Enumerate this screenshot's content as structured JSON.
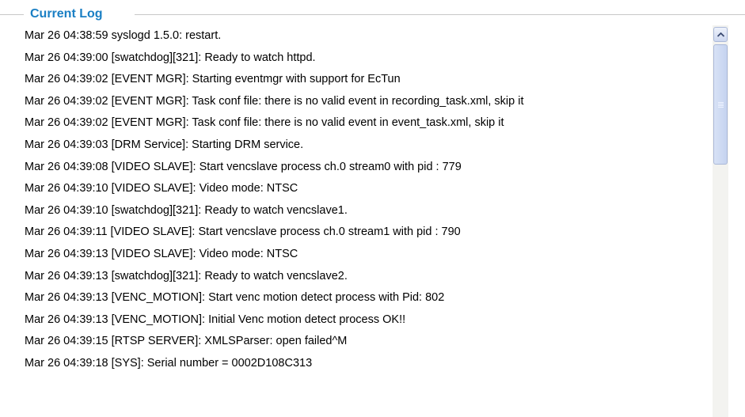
{
  "legend": "Current Log",
  "log": [
    "Mar 26 04:38:59 syslogd 1.5.0: restart.",
    "Mar 26 04:39:00 [swatchdog][321]: Ready to watch httpd.",
    "Mar 26 04:39:02 [EVENT MGR]: Starting eventmgr with support for EcTun",
    "Mar 26 04:39:02 [EVENT MGR]: Task conf file: there is no valid event in recording_task.xml, skip it",
    "Mar 26 04:39:02 [EVENT MGR]: Task conf file: there is no valid event in event_task.xml, skip it",
    "Mar 26 04:39:03 [DRM Service]: Starting DRM service.",
    "Mar 26 04:39:08 [VIDEO SLAVE]: Start vencslave process ch.0 stream0 with pid : 779",
    "Mar 26 04:39:10 [VIDEO SLAVE]: Video mode: NTSC",
    "Mar 26 04:39:10 [swatchdog][321]: Ready to watch vencslave1.",
    "Mar 26 04:39:11 [VIDEO SLAVE]: Start vencslave process ch.0 stream1 with pid : 790",
    "Mar 26 04:39:13 [VIDEO SLAVE]: Video mode: NTSC",
    "Mar 26 04:39:13 [swatchdog][321]: Ready to watch vencslave2.",
    "Mar 26 04:39:13 [VENC_MOTION]: Start venc motion detect process with Pid: 802",
    "Mar 26 04:39:13 [VENC_MOTION]: Initial Venc motion detect process OK!!",
    "Mar 26 04:39:15 [RTSP SERVER]: XMLSParser: open failed^M",
    "Mar 26 04:39:18 [SYS]: Serial number = 0002D108C313"
  ],
  "scrollbar": {
    "up_icon": "chevron-up-icon",
    "accent": "#1a7fc4"
  }
}
